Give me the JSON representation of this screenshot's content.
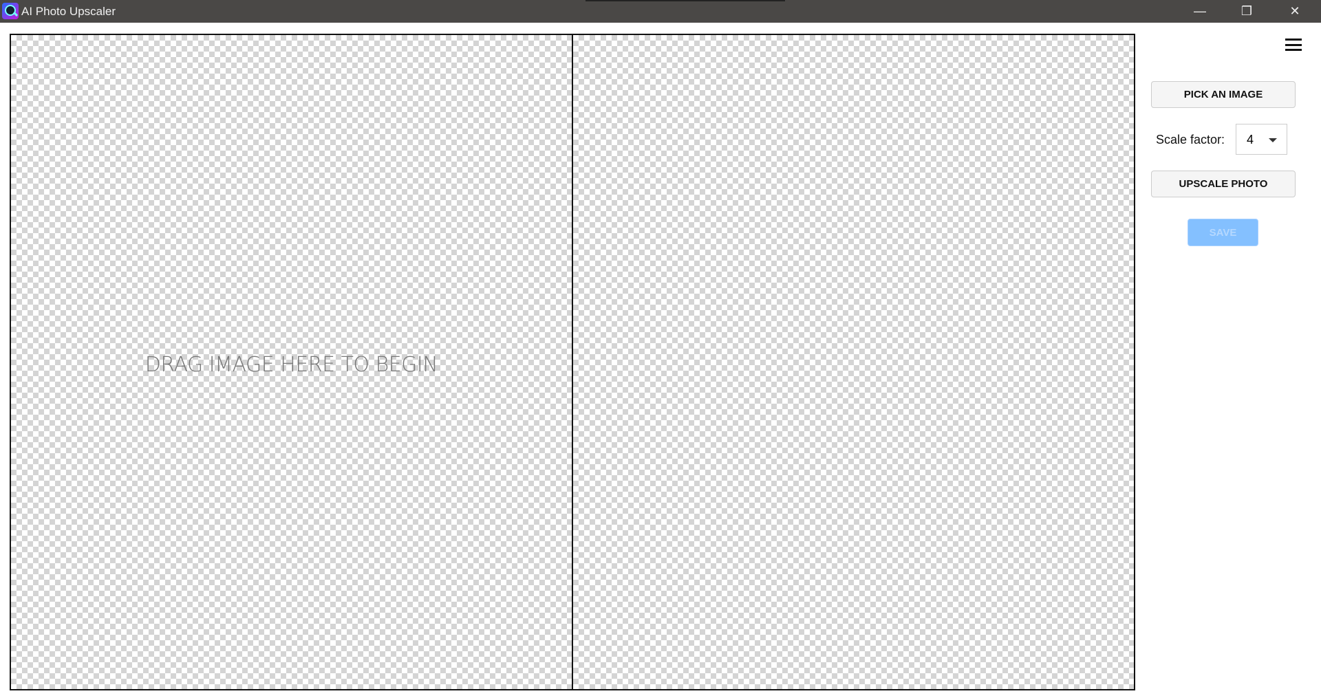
{
  "window": {
    "title": "AI Photo Upscaler",
    "controls": {
      "minimize": "—",
      "maximize": "❐",
      "close": "✕"
    }
  },
  "canvas": {
    "drop_hint": "DRAG IMAGE HERE TO BEGIN"
  },
  "panel": {
    "pick_label": "PICK AN IMAGE",
    "scale_label": "Scale factor:",
    "scale_value": "4",
    "upscale_label": "UPSCALE PHOTO",
    "save_label": "SAVE",
    "save_enabled": false
  },
  "colors": {
    "titlebar": "#4a4846",
    "save_disabled": "#84c0ff"
  }
}
